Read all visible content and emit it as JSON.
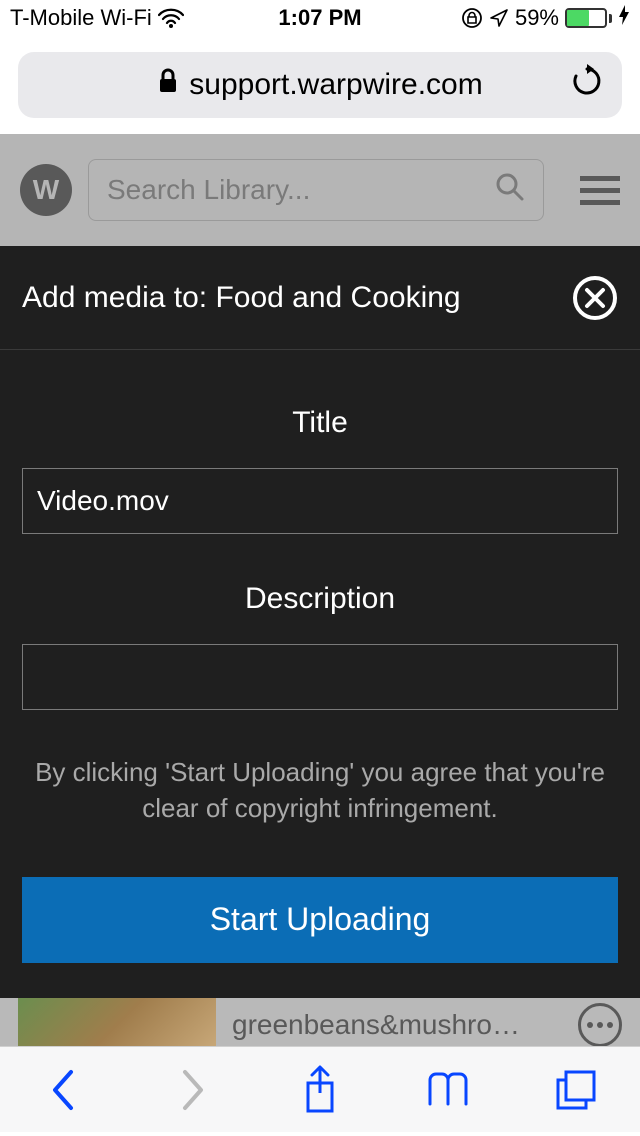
{
  "status": {
    "carrier": "T-Mobile Wi-Fi",
    "time": "1:07 PM",
    "battery_pct": "59%",
    "battery_fill_pct": 59
  },
  "browser": {
    "url_display": "support.warpwire.com"
  },
  "page": {
    "search_placeholder": "Search Library...",
    "list_item_title": "greenbeans&mushro…"
  },
  "modal": {
    "heading": "Add media to: Food and Cooking",
    "title_label": "Title",
    "title_value": "Video.mov",
    "desc_label": "Description",
    "desc_value": "",
    "disclaimer": "By clicking 'Start Uploading' you agree that you're clear of copyright infringement.",
    "upload_label": "Start Uploading"
  }
}
